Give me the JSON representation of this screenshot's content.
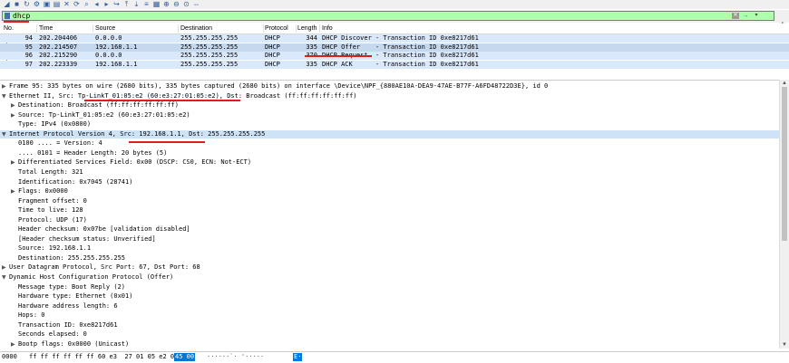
{
  "toolbar": {
    "icons": [
      "shark-fin-icon",
      "stop-icon",
      "restart-icon",
      "options-gear-icon",
      "open-file-icon",
      "save-icon",
      "close-file-icon",
      "reload-icon",
      "find-icon",
      "back-icon",
      "forward-icon",
      "goto-icon",
      "first-icon",
      "last-icon",
      "autoscroll-icon",
      "colorize-icon",
      "zoom-in-icon",
      "zoom-out-icon",
      "zoom-reset-icon",
      "resize-columns-icon"
    ]
  },
  "filter": {
    "value": "dhcp",
    "clear_label": "✕",
    "apply_label": "→",
    "plus_label": "+"
  },
  "packet_list": {
    "columns": [
      "No.",
      "Time",
      "Source",
      "Destination",
      "Protocol",
      "Length",
      "Info"
    ],
    "rows": [
      {
        "no": "94",
        "time": "202.204406",
        "src": "0.0.0.0",
        "dst": "255.255.255.255",
        "proto": "DHCP",
        "len": "344",
        "info": "DHCP Discover - Transaction ID 0xe8217d61"
      },
      {
        "no": "95",
        "time": "202.214507",
        "src": "192.168.1.1",
        "dst": "255.255.255.255",
        "proto": "DHCP",
        "len": "335",
        "info": "DHCP Offer    - Transaction ID 0xe8217d61"
      },
      {
        "no": "96",
        "time": "202.215290",
        "src": "0.0.0.0",
        "dst": "255.255.255.255",
        "proto": "DHCP",
        "len": "370",
        "info": "DHCP Request  - Transaction ID 0xe8217d61"
      },
      {
        "no": "97",
        "time": "202.223339",
        "src": "192.168.1.1",
        "dst": "255.255.255.255",
        "proto": "DHCP",
        "len": "335",
        "info": "DHCP ACK      - Transaction ID 0xe8217d61"
      }
    ]
  },
  "details": [
    {
      "arrow": ">",
      "indent": 0,
      "text": "Frame 95: 335 bytes on wire (2680 bits), 335 bytes captured (2680 bits) on interface \\Device\\NPF_{880AE10A-DEA9-47AE-B77F-A6FD48722D3E}, id 0"
    },
    {
      "arrow": "v",
      "indent": 0,
      "text": "Ethernet II, Src: Tp-LinkT_01:05:e2 (60:e3:27:01:05:e2), Dst: Broadcast (ff:ff:ff:ff:ff:ff)"
    },
    {
      "arrow": ">",
      "indent": 1,
      "text": "Destination: Broadcast (ff:ff:ff:ff:ff:ff)"
    },
    {
      "arrow": ">",
      "indent": 1,
      "text": "Source: Tp-LinkT_01:05:e2 (60:e3:27:01:05:e2)"
    },
    {
      "arrow": "",
      "indent": 1,
      "text": "Type: IPv4 (0x0800)"
    },
    {
      "arrow": "v",
      "indent": 0,
      "text": "Internet Protocol Version 4, Src: 192.168.1.1, Dst: 255.255.255.255"
    },
    {
      "arrow": "",
      "indent": 1,
      "text": "0100 .... = Version: 4"
    },
    {
      "arrow": "",
      "indent": 1,
      "text": ".... 0101 = Header Length: 20 bytes (5)"
    },
    {
      "arrow": ">",
      "indent": 1,
      "text": "Differentiated Services Field: 0x00 (DSCP: CS0, ECN: Not-ECT)"
    },
    {
      "arrow": "",
      "indent": 1,
      "text": "Total Length: 321"
    },
    {
      "arrow": "",
      "indent": 1,
      "text": "Identification: 0x7045 (28741)"
    },
    {
      "arrow": ">",
      "indent": 1,
      "text": "Flags: 0x0000"
    },
    {
      "arrow": "",
      "indent": 1,
      "text": "Fragment offset: 0"
    },
    {
      "arrow": "",
      "indent": 1,
      "text": "Time to live: 128"
    },
    {
      "arrow": "",
      "indent": 1,
      "text": "Protocol: UDP (17)"
    },
    {
      "arrow": "",
      "indent": 1,
      "text": "Header checksum: 0x07be [validation disabled]"
    },
    {
      "arrow": "",
      "indent": 1,
      "text": "[Header checksum status: Unverified]"
    },
    {
      "arrow": "",
      "indent": 1,
      "text": "Source: 192.168.1.1"
    },
    {
      "arrow": "",
      "indent": 1,
      "text": "Destination: 255.255.255.255"
    },
    {
      "arrow": ">",
      "indent": 0,
      "text": "User Datagram Protocol, Src Port: 67, Dst Port: 68"
    },
    {
      "arrow": "v",
      "indent": 0,
      "text": "Dynamic Host Configuration Protocol (Offer)"
    },
    {
      "arrow": "",
      "indent": 1,
      "text": "Message type: Boot Reply (2)"
    },
    {
      "arrow": "",
      "indent": 1,
      "text": "Hardware type: Ethernet (0x01)"
    },
    {
      "arrow": "",
      "indent": 1,
      "text": "Hardware address length: 6"
    },
    {
      "arrow": "",
      "indent": 1,
      "text": "Hops: 0"
    },
    {
      "arrow": "",
      "indent": 1,
      "text": "Transaction ID: 0xe8217d61"
    },
    {
      "arrow": "",
      "indent": 1,
      "text": "Seconds elapsed: 0"
    },
    {
      "arrow": ">",
      "indent": 1,
      "text": "Bootp flags: 0x0000 (Unicast)"
    }
  ],
  "bytes": {
    "offset": "0000",
    "hex": "ff ff ff ff ff ff 60 e3  27 01 05 e2 08 00",
    "hex_hl": "45 00",
    "ascii": "······`· '·····",
    "ascii_hl": "E·"
  },
  "colors": {
    "filter_ok": "#afffaf",
    "row_highlight": "#dae8fc",
    "selected_row": "#c6d8ee",
    "annotation_red": "#e11c1c",
    "bytes_highlight": "#0078d7"
  }
}
